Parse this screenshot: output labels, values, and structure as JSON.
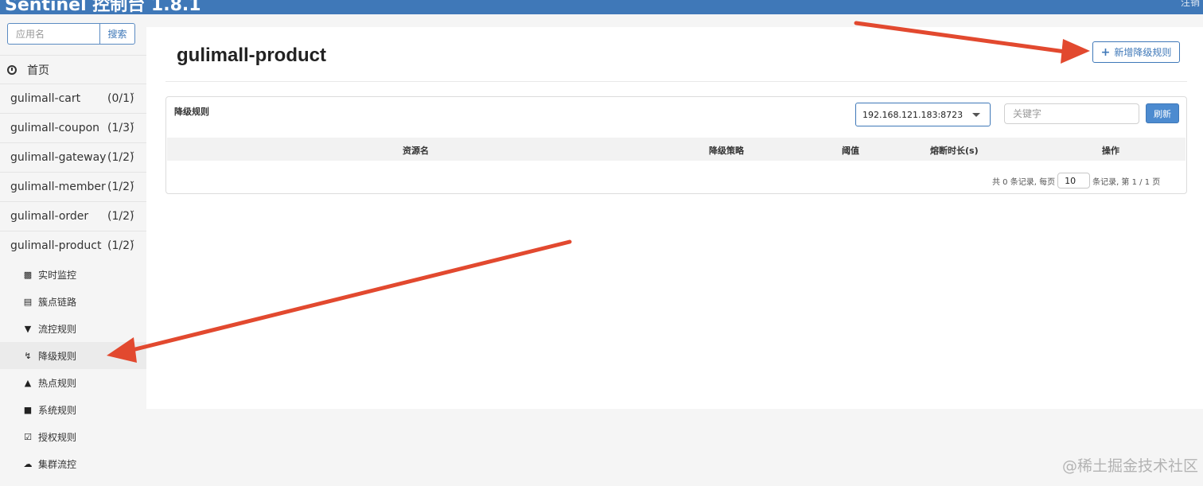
{
  "header": {
    "title": "Sentinel 控制台 1.8.1",
    "logout_label": "注销"
  },
  "sidebar": {
    "search": {
      "placeholder": "应用名",
      "button_label": "搜索"
    },
    "home_label": "首页",
    "apps": [
      {
        "name": "gulimall-cart",
        "count": "(0/1)"
      },
      {
        "name": "gulimall-coupon",
        "count": "(1/3)"
      },
      {
        "name": "gulimall-gateway",
        "count": "(1/2)"
      },
      {
        "name": "gulimall-member",
        "count": "(1/2)"
      },
      {
        "name": "gulimall-order",
        "count": "(1/2)"
      },
      {
        "name": "gulimall-product",
        "count": "(1/2)"
      }
    ],
    "submenu": [
      {
        "label": "实时监控",
        "icon": "bar-chart-icon"
      },
      {
        "label": "簇点链路",
        "icon": "list-icon"
      },
      {
        "label": "流控规则",
        "icon": "filter-icon"
      },
      {
        "label": "降级规则",
        "icon": "flash-icon",
        "active": true
      },
      {
        "label": "热点规则",
        "icon": "fire-icon"
      },
      {
        "label": "系统规则",
        "icon": "lock-icon"
      },
      {
        "label": "授权规则",
        "icon": "check-icon"
      },
      {
        "label": "集群流控",
        "icon": "cloud-icon"
      }
    ]
  },
  "main": {
    "page_title": "gulimall-product",
    "add_button_label": "新增降级规则",
    "panel_label": "降级规则",
    "machine_select": "192.168.121.183:8723",
    "keyword_placeholder": "关键字",
    "refresh_label": "刷新",
    "columns": [
      "资源名",
      "降级策略",
      "阈值",
      "熔断时长(s)",
      "操作"
    ],
    "pager": {
      "prefix": "共 0 条记录, 每页",
      "page_size": "10",
      "suffix": "条记录, 第 1 / 1 页"
    }
  },
  "watermark": "@稀土掘金技术社区",
  "colors": {
    "topbar": "#3f78b8",
    "accent": "#3f78b8",
    "arrow": "#e2492f"
  }
}
